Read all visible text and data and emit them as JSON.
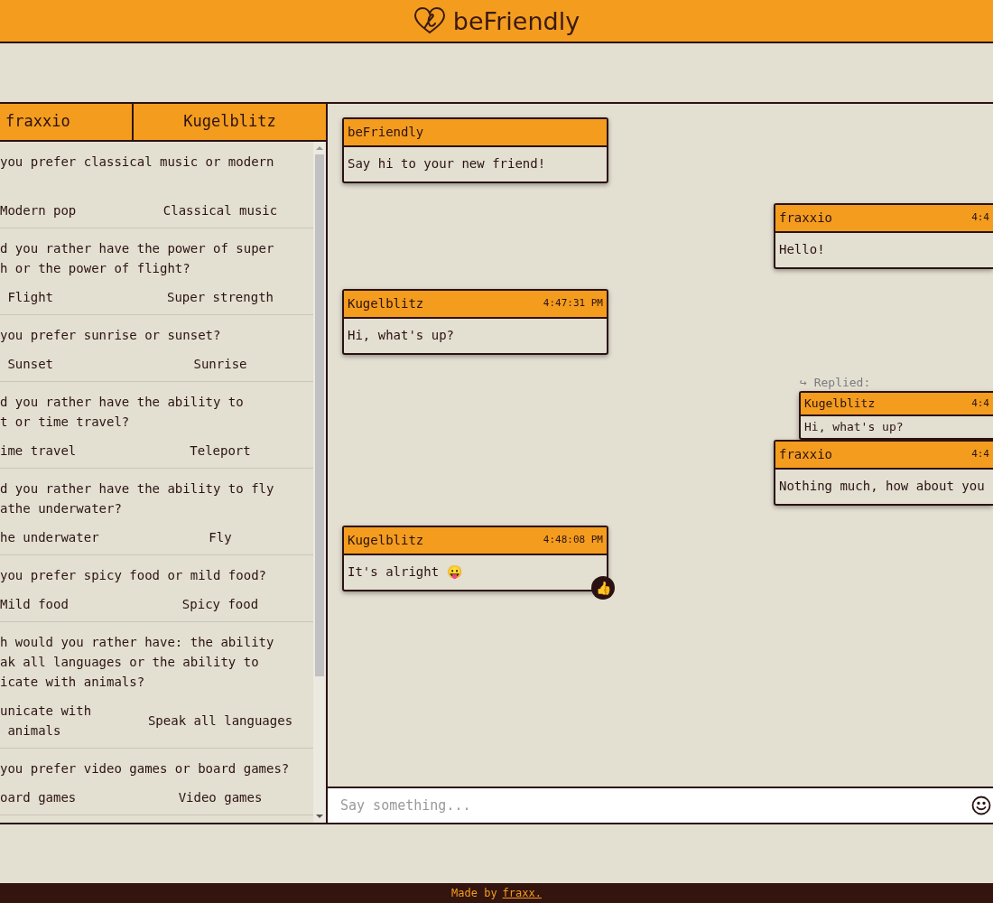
{
  "header": {
    "title": "beFriendly"
  },
  "answers_panel": {
    "players": [
      "fraxxio",
      "Kugelblitz"
    ],
    "questions": [
      {
        "question": "you prefer classical music or modern\n ",
        "answers": [
          "Modern pop",
          "Classical music"
        ]
      },
      {
        "question": "d you rather have the power of super\nh or the power of flight?",
        "answers": [
          " Flight",
          "Super strength"
        ]
      },
      {
        "question": "you prefer sunrise or sunset?",
        "answers": [
          " Sunset",
          "Sunrise"
        ]
      },
      {
        "question": "d you rather have the ability to\nt or time travel?",
        "answers": [
          "ime travel",
          "Teleport"
        ]
      },
      {
        "question": "d you rather have the ability to fly\nathe underwater?",
        "answers": [
          "he underwater",
          "Fly"
        ]
      },
      {
        "question": "you prefer spicy food or mild food?",
        "answers": [
          "Mild food",
          "Spicy food"
        ]
      },
      {
        "question": "h would you rather have: the ability\nak all languages or the ability to\nicate with animals?",
        "answers": [
          "unicate with\n animals",
          "Speak all languages"
        ]
      },
      {
        "question": "you prefer video games or board games?",
        "answers": [
          "oard games",
          "Video games"
        ]
      }
    ]
  },
  "chat": {
    "messages": [
      {
        "kind": "received",
        "sender": "beFriendly",
        "text": "Say hi to your new friend!"
      },
      {
        "kind": "sent",
        "sender": "fraxxio",
        "time": "4:4",
        "text": "Hello!"
      },
      {
        "kind": "received",
        "sender": "Kugelblitz",
        "time": "4:47:31 PM",
        "text": "Hi, what's up?"
      },
      {
        "kind": "sent",
        "sender": "fraxxio",
        "time": "4:4",
        "text": "Nothing much, how about you",
        "reply": {
          "label": "↪ Replied:",
          "sender": "Kugelblitz",
          "time": "4:4",
          "text": "Hi, what's up?"
        }
      },
      {
        "kind": "received",
        "sender": "Kugelblitz",
        "time": "4:48:08 PM",
        "text": "It's alright 😛",
        "reaction": "👍"
      }
    ],
    "input": {
      "placeholder": "Say something..."
    }
  },
  "footer": {
    "text": "Made by",
    "link": "fraxx."
  }
}
